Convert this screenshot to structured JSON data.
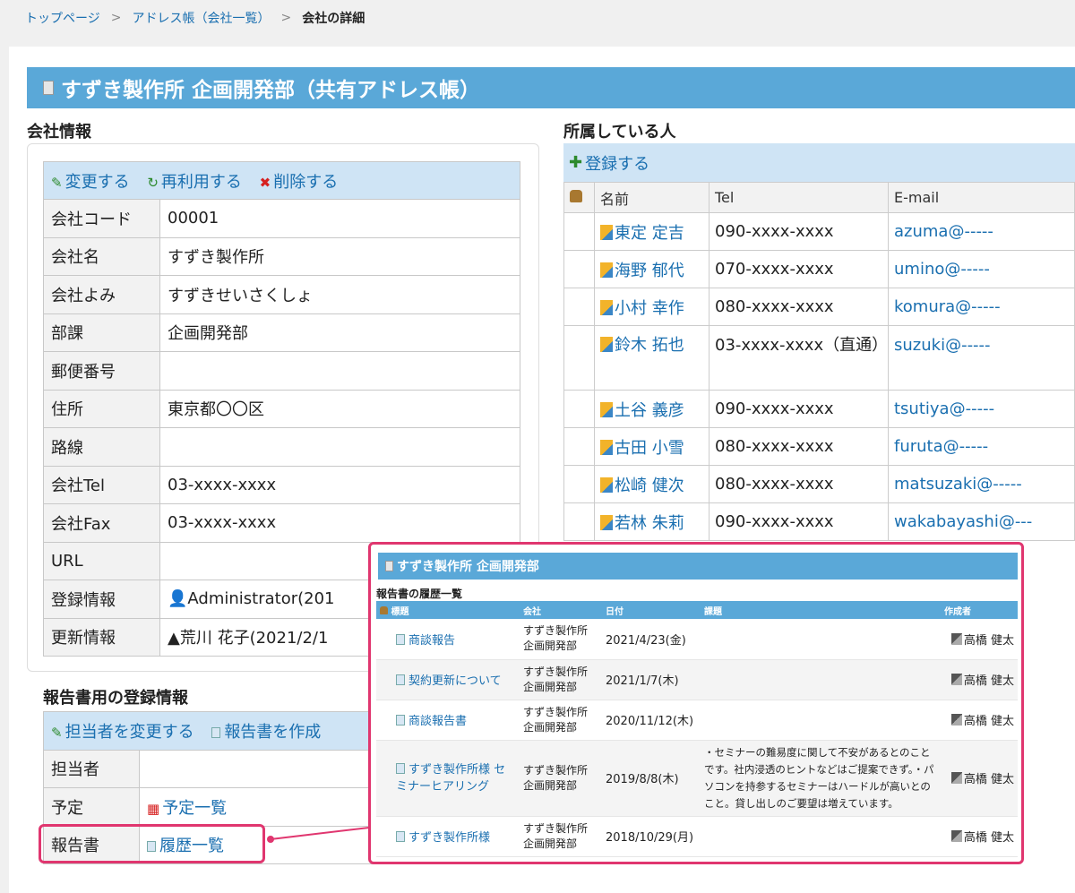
{
  "breadcrumb": {
    "top": "トップページ",
    "sep": ">",
    "addr": "アドレス帳（会社一覧）",
    "current": "会社の詳細"
  },
  "title": "すずき製作所 企画開発部（共有アドレス帳）",
  "company_section": {
    "heading": "会社情報",
    "actions": {
      "edit": "変更する",
      "reuse": "再利用する",
      "delete": "削除する"
    },
    "rows": [
      {
        "label": "会社コード",
        "value": "00001"
      },
      {
        "label": "会社名",
        "value": "すずき製作所"
      },
      {
        "label": "会社よみ",
        "value": "すずきせいさくしょ"
      },
      {
        "label": "部課",
        "value": "企画開発部"
      },
      {
        "label": "郵便番号",
        "value": ""
      },
      {
        "label": "住所",
        "value": "東京都〇〇区"
      },
      {
        "label": "路線",
        "value": ""
      },
      {
        "label": "会社Tel",
        "value": "03-xxxx-xxxx"
      },
      {
        "label": "会社Fax",
        "value": "03-xxxx-xxxx"
      },
      {
        "label": "URL",
        "value": ""
      },
      {
        "label": "登録情報",
        "value": "Administrator(201"
      },
      {
        "label": "更新情報",
        "value": "荒川 花子(2021/2/1"
      }
    ]
  },
  "report_section": {
    "heading": "報告書用の登録情報",
    "actions": {
      "change_person": "担当者を変更する",
      "create_report": "報告書を作成"
    },
    "rows": [
      {
        "label": "担当者",
        "value": ""
      },
      {
        "label": "予定",
        "value": "予定一覧"
      },
      {
        "label": "報告書",
        "value": "履歴一覧"
      }
    ]
  },
  "members_section": {
    "heading": "所属している人",
    "register": "登録する",
    "columns": {
      "name": "名前",
      "tel": "Tel",
      "email": "E-mail"
    },
    "rows": [
      {
        "name": "東定 定吉",
        "tel": "090-xxxx-xxxx",
        "email": "azuma@-----"
      },
      {
        "name": "海野 郁代",
        "tel": "070-xxxx-xxxx",
        "email": "umino@-----"
      },
      {
        "name": "小村 幸作",
        "tel": "080-xxxx-xxxx",
        "email": "komura@-----"
      },
      {
        "name": "鈴木 拓也",
        "tel": "03-xxxx-xxxx（直通）",
        "email": "suzuki@-----"
      },
      {
        "name": "土谷 義彦",
        "tel": "090-xxxx-xxxx",
        "email": "tsutiya@-----"
      },
      {
        "name": "古田 小雪",
        "tel": "080-xxxx-xxxx",
        "email": "furuta@-----"
      },
      {
        "name": "松崎 健次",
        "tel": "080-xxxx-xxxx",
        "email": "matsuzaki@-----"
      },
      {
        "name": "若林 朱莉",
        "tel": "090-xxxx-xxxx",
        "email": "wakabayashi@---"
      }
    ]
  },
  "popup": {
    "title": "すずき製作所 企画開発部",
    "subtitle": "報告書の履歴一覧",
    "columns": {
      "subject": "標題",
      "company": "会社",
      "date": "日付",
      "issue": "課題",
      "author": "作成者"
    },
    "rows": [
      {
        "subject": "商談報告",
        "company1": "すずき製作所",
        "company2": "企画開発部",
        "date": "2021/4/23(金)",
        "issue": "",
        "author": "高橋 健太"
      },
      {
        "subject": "契約更新について",
        "company1": "すずき製作所",
        "company2": "企画開発部",
        "date": "2021/1/7(木)",
        "issue": "",
        "author": "高橋 健太"
      },
      {
        "subject": "商談報告書",
        "company1": "すずき製作所",
        "company2": "企画開発部",
        "date": "2020/11/12(木)",
        "issue": "",
        "author": "高橋 健太"
      },
      {
        "subject": "すずき製作所様 セミナーヒアリング",
        "company1": "すずき製作所",
        "company2": "企画開発部",
        "date": "2019/8/8(木)",
        "issue": "・セミナーの難易度に関して不安があるとのことです。社内浸透のヒントなどはご提案できず。・パソコンを持参するセミナーはハードルが高いとのこと。貸し出しのご要望は増えています。",
        "author": "高橋 健太"
      },
      {
        "subject": "すずき製作所様",
        "company1": "すずき製作所",
        "company2": "企画開発部",
        "date": "2018/10/29(月)",
        "issue": "",
        "author": "高橋 健太"
      }
    ]
  },
  "colors": {
    "title_bar": "#5aa8d8",
    "toolbar_bg": "#cfe4f5",
    "link": "#1a6fb0",
    "highlight": "#e0366f"
  }
}
